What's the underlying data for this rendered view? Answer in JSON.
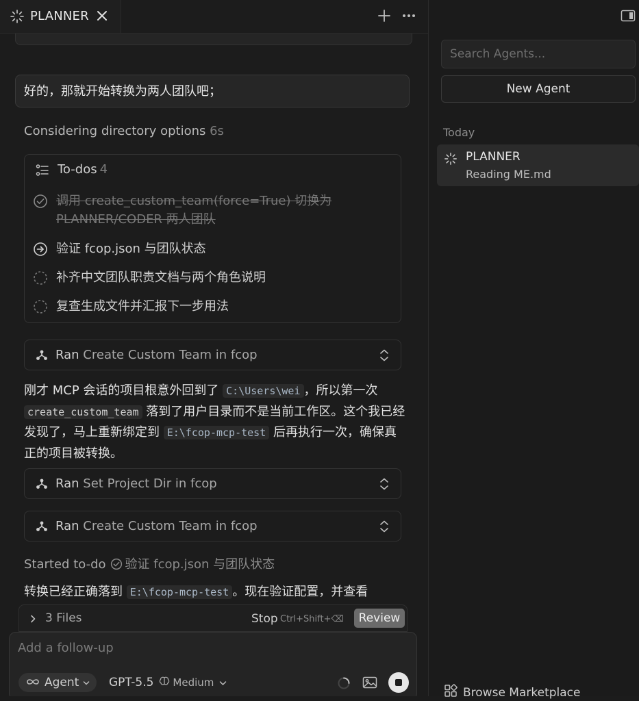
{
  "tab": {
    "title": "PLANNER"
  },
  "chat": {
    "user_message": "好的，那就开始转换为两人团队吧；",
    "thinking": {
      "label": "Considering directory options",
      "duration": "6s"
    },
    "todos": {
      "title": "To-dos",
      "count": "4",
      "items": [
        {
          "text": "调用 create_custom_team(force=True) 切换为 PLANNER/CODER 两人团队",
          "status": "done"
        },
        {
          "text": "验证 fcop.json 与团队状态",
          "status": "in-progress"
        },
        {
          "text": "补齐中文团队职责文档与两个角色说明",
          "status": "pending"
        },
        {
          "text": "复查生成文件并汇报下一步用法",
          "status": "pending"
        }
      ]
    },
    "tool_calls": [
      {
        "verb": "Ran",
        "name": "Create Custom Team in fcop"
      },
      {
        "verb": "Ran",
        "name": "Set Project Dir in fcop"
      },
      {
        "verb": "Ran",
        "name": "Create Custom Team in fcop"
      }
    ],
    "paragraph1": {
      "t1": "刚才 MCP 会话的项目根意外回到了 ",
      "c1": "C:\\Users\\wei",
      "t2": "，所以第一次 ",
      "c2": "create_custom_team",
      "t3": " 落到了用户目录而不是当前工作区。这个我已经发现了，马上重新绑定到 ",
      "c3": "E:\\fcop-mcp-test",
      "t4": " 后再执行一次，确保真正的项目被转换。"
    },
    "started_todo": {
      "label": "Started to-do",
      "name": "验证 fcop.json 与团队状态"
    },
    "paragraph2": {
      "t1": "转换已经正确落到 ",
      "c1": "E:\\fcop-mcp-test",
      "t2": "。现在验证配置，并查看"
    }
  },
  "files_bar": {
    "files_label": "3 Files",
    "stop_label": "Stop",
    "stop_shortcut": "Ctrl+Shift+⌫",
    "review_label": "Review"
  },
  "composer": {
    "placeholder": "Add a follow-up",
    "mode": "Agent",
    "model": "GPT-5.5",
    "effort": "Medium"
  },
  "sidebar": {
    "search_placeholder": "Search Agents...",
    "new_agent_label": "New Agent",
    "section_label": "Today",
    "agents": [
      {
        "name": "PLANNER",
        "status": "Reading ME.md"
      }
    ],
    "marketplace_label": "Browse Marketplace"
  }
}
